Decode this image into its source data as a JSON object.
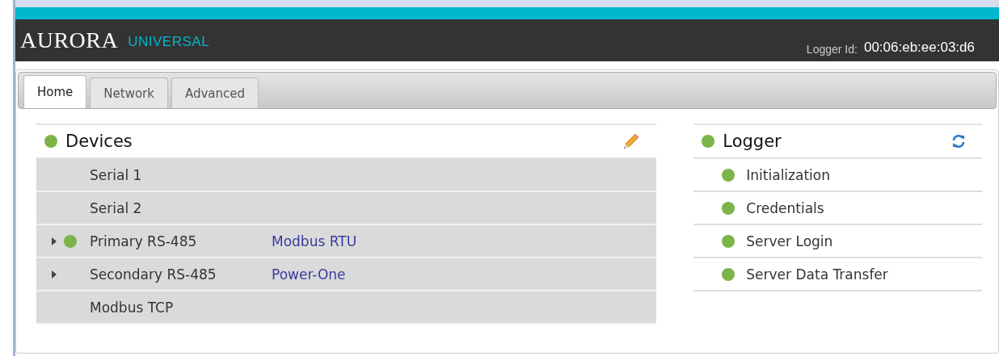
{
  "header": {
    "brand": "AURORA",
    "product": "UNIVERSAL",
    "logger_id_label": "Logger Id:",
    "logger_id": "00:06:eb:ee:03:d6"
  },
  "tabs": [
    {
      "label": "Home",
      "selected": true
    },
    {
      "label": "Network",
      "selected": false
    },
    {
      "label": "Advanced",
      "selected": false
    }
  ],
  "devices": {
    "title": "Devices",
    "color": "#7cb44a",
    "rows": [
      {
        "name": "Serial 1",
        "expandable": false
      },
      {
        "name": "Serial 2",
        "expandable": false
      },
      {
        "name": "Primary RS-485",
        "expandable": true,
        "color": "#7cb44a",
        "protocol": "Modbus RTU"
      },
      {
        "name": "Secondary RS-485",
        "expandable": true,
        "protocol": "Power-One"
      },
      {
        "name": "Modbus TCP",
        "expandable": false
      }
    ]
  },
  "logger": {
    "title": "Logger",
    "color": "#7cb44a",
    "items": [
      {
        "label": "Initialization",
        "color": "#7cb44a"
      },
      {
        "label": "Credentials",
        "color": "#7cb44a"
      },
      {
        "label": "Server Login",
        "color": "#7cb44a"
      },
      {
        "label": "Server Data Transfer",
        "color": "#7cb44a"
      }
    ]
  }
}
